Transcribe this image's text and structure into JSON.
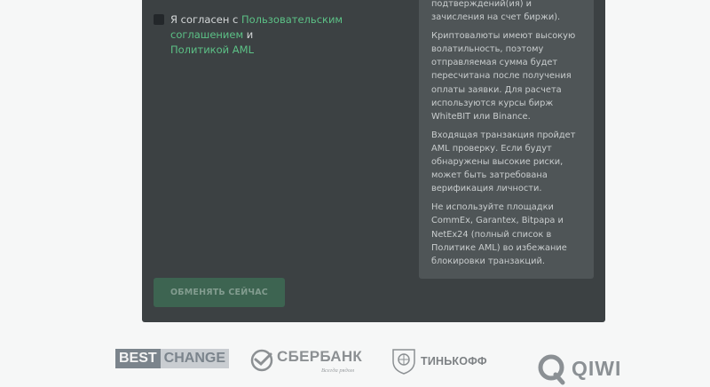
{
  "agreement": {
    "prefix": "Я согласен с ",
    "user_agreement_link": "Пользовательским соглашением",
    "conjunction": " и",
    "aml_link": "Политикой AML"
  },
  "info": {
    "p1": "подтверждений(ия) и зачисления на счет биржи).",
    "p2": "Криптовалюты имеют высокую волатильность, поэтому отправляемая сумма будет пересчитана после получения оплаты заявки. Для расчета используются курсы бирж WhiteBIT или Binance.",
    "p3": "Входящая транзакция пройдет AML проверку. Если будут обнаружены высокие риски, может быть затребована верификация личности.",
    "p4": "Не используйте площадки CommEx, Garantex, Bitpapa и NetEx24 (полный список в Политике AML) во избежание блокировки транзакций."
  },
  "submit_label": "ОБМЕНЯТЬ СЕЙЧАС",
  "partners": {
    "bestchange_best": "BEST",
    "bestchange_change": "CHANGE",
    "sberbank": "СБЕРБАНК",
    "sberbank_slogan": "Всегда рядом",
    "tinkoff": "ТИНЬКОФФ",
    "qiwi": "QIWI"
  },
  "colors": {
    "panel": "#3c4143",
    "info_box": "#4f5557",
    "link": "#5cc186",
    "button": "#3d6451"
  }
}
